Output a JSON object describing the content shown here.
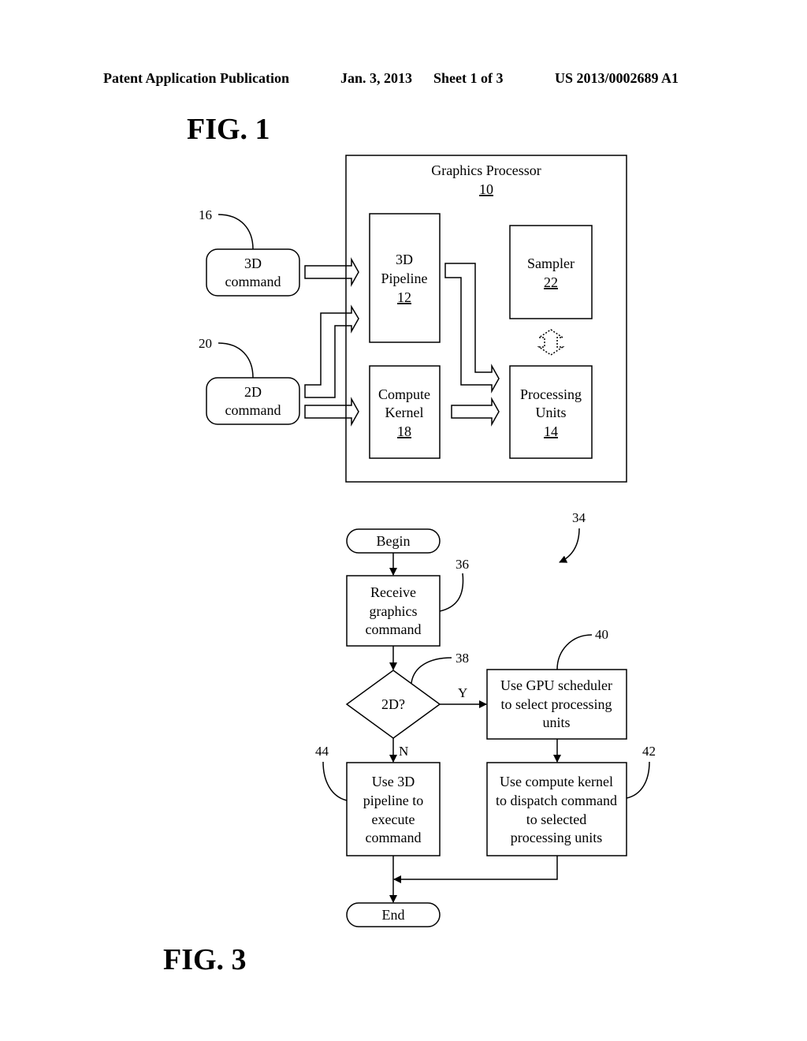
{
  "header": {
    "publication": "Patent Application Publication",
    "date": "Jan. 3, 2013",
    "sheet": "Sheet 1 of 3",
    "number": "US 2013/0002689 A1"
  },
  "fig1": {
    "title": "FIG. 1",
    "graphics_processor": {
      "label": "Graphics Processor",
      "ref": "10"
    },
    "cmd_3d": {
      "lines": [
        "3D",
        "command"
      ],
      "ref": "16"
    },
    "cmd_2d": {
      "lines": [
        "2D",
        "command"
      ],
      "ref": "20"
    },
    "pipeline_3d": {
      "lines": [
        "3D",
        "Pipeline"
      ],
      "ref": "12"
    },
    "compute_kernel": {
      "lines": [
        "Compute",
        "Kernel"
      ],
      "ref": "18"
    },
    "sampler": {
      "lines": [
        "Sampler"
      ],
      "ref": "22"
    },
    "processing_units": {
      "lines": [
        "Processing",
        "Units"
      ],
      "ref": "14"
    }
  },
  "fig3": {
    "title": "FIG. 3",
    "ref": "34",
    "begin": "Begin",
    "end": "End",
    "receive": {
      "lines": [
        "Receive",
        "graphics",
        "command"
      ],
      "ref": "36"
    },
    "decision": {
      "label": "2D?",
      "ref": "38",
      "yes": "Y",
      "no": "N"
    },
    "scheduler": {
      "lines": [
        "Use GPU scheduler",
        "to select processing",
        "units"
      ],
      "ref": "40"
    },
    "dispatch": {
      "lines": [
        "Use compute kernel",
        "to dispatch command",
        "to selected",
        "processing units"
      ],
      "ref": "42"
    },
    "pipeline": {
      "lines": [
        "Use 3D",
        "pipeline to",
        "execute",
        "command"
      ],
      "ref": "44"
    }
  }
}
